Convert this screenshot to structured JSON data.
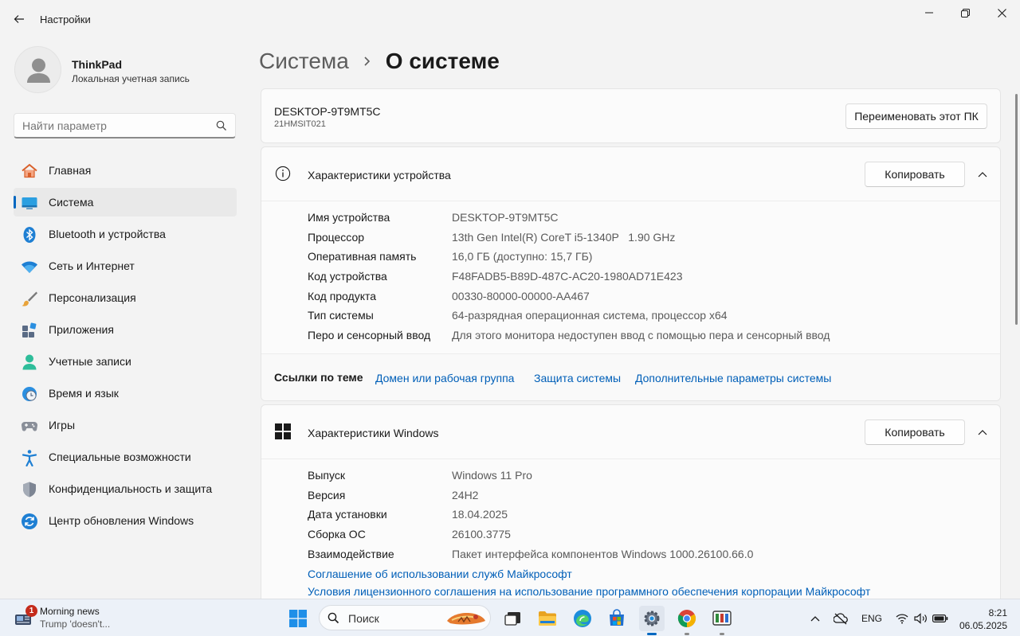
{
  "window": {
    "title": "Настройки"
  },
  "profile": {
    "name": "ThinkPad",
    "account_type": "Локальная учетная запись"
  },
  "search": {
    "placeholder": "Найти параметр"
  },
  "sidebar": {
    "items": [
      {
        "label": "Главная",
        "icon": "home-icon",
        "active": false
      },
      {
        "label": "Система",
        "icon": "system-icon",
        "active": true
      },
      {
        "label": "Bluetooth и устройства",
        "icon": "bluetooth-icon",
        "active": false
      },
      {
        "label": "Сеть и Интернет",
        "icon": "wifi-icon",
        "active": false
      },
      {
        "label": "Персонализация",
        "icon": "brush-icon",
        "active": false
      },
      {
        "label": "Приложения",
        "icon": "apps-icon",
        "active": false
      },
      {
        "label": "Учетные записи",
        "icon": "account-icon",
        "active": false
      },
      {
        "label": "Время и язык",
        "icon": "clock-globe-icon",
        "active": false
      },
      {
        "label": "Игры",
        "icon": "gamepad-icon",
        "active": false
      },
      {
        "label": "Специальные возможности",
        "icon": "accessibility-icon",
        "active": false
      },
      {
        "label": "Конфиденциальность и защита",
        "icon": "shield-icon",
        "active": false
      },
      {
        "label": "Центр обновления Windows",
        "icon": "update-icon",
        "active": false
      }
    ]
  },
  "breadcrumb": {
    "parent": "Система",
    "current": "О системе"
  },
  "pc": {
    "name": "DESKTOP-9T9MT5C",
    "model": "21HMSIT021",
    "rename_label": "Переименовать этот ПК"
  },
  "device_specs": {
    "title": "Характеристики устройства",
    "copy_label": "Копировать",
    "rows": [
      {
        "label": "Имя устройства",
        "value": "DESKTOP-9T9MT5C"
      },
      {
        "label": "Процессор",
        "value": "13th Gen Intel(R) CoreT i5-1340P   1.90 GHz"
      },
      {
        "label": "Оперативная память",
        "value": "16,0 ГБ (доступно: 15,7 ГБ)"
      },
      {
        "label": "Код устройства",
        "value": "F48FADB5-B89D-487C-AC20-1980AD71E423"
      },
      {
        "label": "Код продукта",
        "value": "00330-80000-00000-AA467"
      },
      {
        "label": "Тип системы",
        "value": "64-разрядная операционная система, процессор x64"
      },
      {
        "label": "Перо и сенсорный ввод",
        "value": "Для этого монитора недоступен ввод с помощью пера и сенсорный ввод"
      }
    ]
  },
  "related": {
    "title": "Ссылки по теме",
    "links": [
      "Домен или рабочая группа",
      "Защита системы",
      "Дополнительные параметры системы"
    ]
  },
  "windows_specs": {
    "title": "Характеристики Windows",
    "copy_label": "Копировать",
    "rows": [
      {
        "label": "Выпуск",
        "value": "Windows 11 Pro"
      },
      {
        "label": "Версия",
        "value": "24H2"
      },
      {
        "label": "Дата установки",
        "value": "18.04.2025"
      },
      {
        "label": "Сборка ОС",
        "value": "26100.3775"
      },
      {
        "label": "Взаимодействие",
        "value": "Пакет интерфейса компонентов Windows 1000.26100.66.0"
      }
    ],
    "links": [
      "Соглашение об использовании служб Майкрософт",
      "Условия лицензионного соглашения на использование программного обеспечения корпорации Майкрософт"
    ]
  },
  "taskbar": {
    "widget": {
      "badge": "1",
      "title": "Morning news",
      "subtitle": "Trump 'doesn't..."
    },
    "search_label": "Поиск",
    "apps": [
      "start-icon",
      "task-view-icon",
      "file-explorer-icon",
      "edge-icon",
      "store-icon",
      "settings-icon",
      "chrome-icon",
      "app-icon"
    ],
    "language": "ENG",
    "time": "8:21",
    "date": "06.05.2025"
  },
  "colors": {
    "accent": "#0067c0",
    "link": "#005fb8",
    "background": "#f3f3f3",
    "card": "#fbfbfb"
  }
}
